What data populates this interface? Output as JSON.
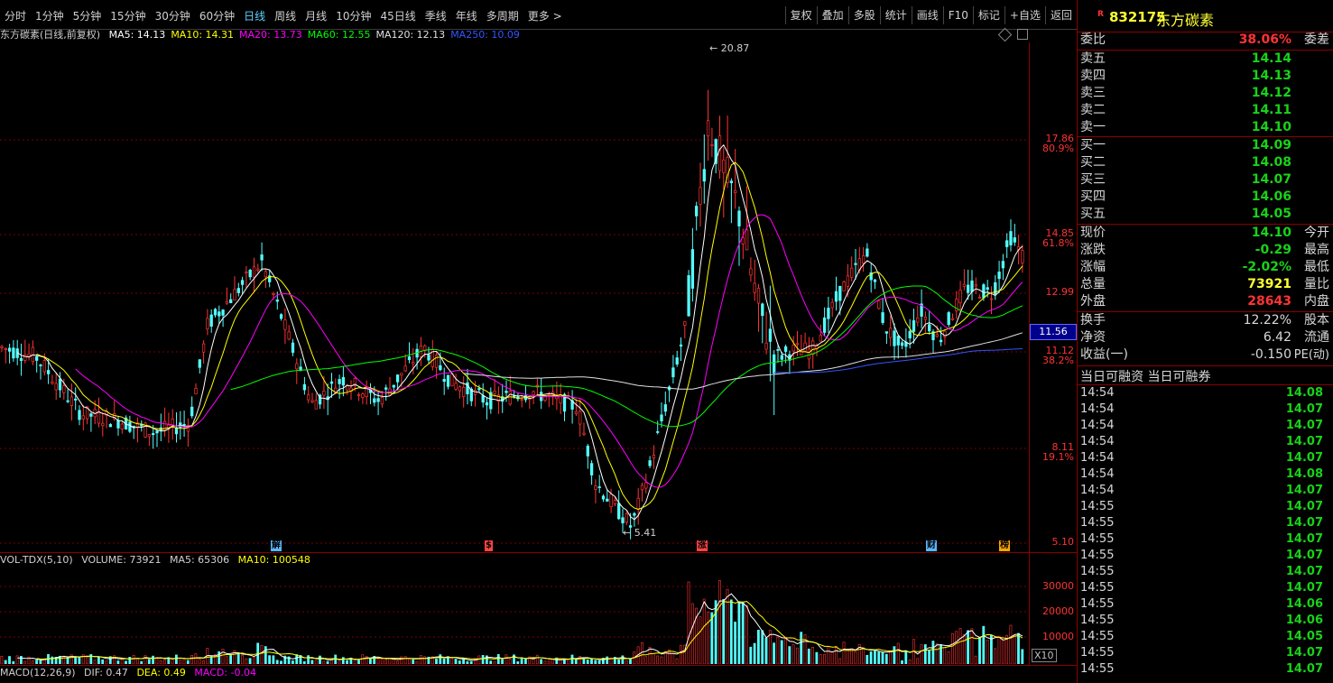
{
  "toolbar": {
    "periods": [
      "分时",
      "1分钟",
      "5分钟",
      "15分钟",
      "30分钟",
      "60分钟",
      "日线",
      "周线",
      "月线",
      "10分钟",
      "45日线",
      "季线",
      "年线",
      "多周期",
      "更多 >"
    ],
    "active_period": "日线",
    "tools": [
      "复权",
      "叠加",
      "多股",
      "统计",
      "画线",
      "F10",
      "标记",
      "+自选",
      "返回"
    ]
  },
  "main_legend": {
    "title": "东方碳素(日线,前复权)",
    "items": [
      {
        "text": "MA5: 14.13",
        "color": "#ffffff"
      },
      {
        "text": "MA10: 14.31",
        "color": "#ffff00"
      },
      {
        "text": "MA20: 13.73",
        "color": "#ff00ff"
      },
      {
        "text": "MA60: 12.55",
        "color": "#00ff00"
      },
      {
        "text": "MA120: 12.13",
        "color": "#e0e0e0"
      },
      {
        "text": "MA250: 10.09",
        "color": "#3355ff"
      }
    ]
  },
  "price_axis": [
    {
      "price": "17.86",
      "pct": "80.9%"
    },
    {
      "price": "14.85",
      "pct": "61.8%"
    },
    {
      "price": "12.99",
      "pct": ""
    },
    {
      "price": "11.12",
      "pct": "38.2%"
    },
    {
      "price": "8.11",
      "pct": "19.1%"
    },
    {
      "price": "5.10",
      "pct": ""
    }
  ],
  "current_price_box": "11.56",
  "high_marker": "20.87",
  "low_marker": "5.41",
  "events": [
    {
      "label": "解",
      "color": "#5bb6ff"
    },
    {
      "label": "$",
      "color": "#ff4444"
    },
    {
      "label": "涨",
      "color": "#ff4444"
    },
    {
      "label": "财",
      "color": "#5bb6ff"
    },
    {
      "label": "榜",
      "color": "#ffa500"
    }
  ],
  "volume_legend": {
    "title": "VOL-TDX(5,10)",
    "volume": "VOLUME: 73921",
    "ma5": "MA5: 65306",
    "ma10": "MA10: 100548"
  },
  "volume_axis": [
    "30000",
    "20000",
    "10000",
    "X10"
  ],
  "macd_legend": {
    "title": "MACD(12,26,9)",
    "dif": "DIF: 0.47",
    "dea": "DEA: 0.49",
    "macd": "MACD: -0.04"
  },
  "quote": {
    "code": "832175",
    "name": "东方碳素",
    "ratio_label": "委比",
    "ratio_value": "38.06%",
    "ratio_label2": "委差",
    "asks": [
      {
        "label": "卖五",
        "price": "14.14"
      },
      {
        "label": "卖四",
        "price": "14.13"
      },
      {
        "label": "卖三",
        "price": "14.12"
      },
      {
        "label": "卖二",
        "price": "14.11"
      },
      {
        "label": "卖一",
        "price": "14.10"
      }
    ],
    "bids": [
      {
        "label": "买一",
        "price": "14.09"
      },
      {
        "label": "买二",
        "price": "14.08"
      },
      {
        "label": "买三",
        "price": "14.07"
      },
      {
        "label": "买四",
        "price": "14.06"
      },
      {
        "label": "买五",
        "price": "14.05"
      }
    ],
    "stats": [
      {
        "label": "现价",
        "value": "14.10",
        "color": "#19d219",
        "label2": "今开"
      },
      {
        "label": "涨跌",
        "value": "-0.29",
        "color": "#19d219",
        "label2": "最高"
      },
      {
        "label": "涨幅",
        "value": "-2.02%",
        "color": "#19d219",
        "label2": "最低"
      },
      {
        "label": "总量",
        "value": "73921",
        "color": "#ffff33",
        "label2": "量比"
      },
      {
        "label": "外盘",
        "value": "28643",
        "color": "#ff3333",
        "label2": "内盘"
      }
    ],
    "stats2": [
      {
        "label": "换手",
        "value": "12.22%",
        "label2": "股本"
      },
      {
        "label": "净资",
        "value": "6.42",
        "label2": "流通"
      },
      {
        "label": "收益(一)",
        "value": "-0.150",
        "label2": "PE(动)"
      }
    ],
    "margin_label": "当日可融资 当日可融券",
    "ticks": [
      {
        "time": "14:54",
        "price": "14.08"
      },
      {
        "time": "14:54",
        "price": "14.07"
      },
      {
        "time": "14:54",
        "price": "14.07"
      },
      {
        "time": "14:54",
        "price": "14.07"
      },
      {
        "time": "14:54",
        "price": "14.07"
      },
      {
        "time": "14:54",
        "price": "14.08"
      },
      {
        "time": "14:54",
        "price": "14.07"
      },
      {
        "time": "14:55",
        "price": "14.07"
      },
      {
        "time": "14:55",
        "price": "14.07"
      },
      {
        "time": "14:55",
        "price": "14.07"
      },
      {
        "time": "14:55",
        "price": "14.07"
      },
      {
        "time": "14:55",
        "price": "14.07"
      },
      {
        "time": "14:55",
        "price": "14.07"
      },
      {
        "time": "14:55",
        "price": "14.06"
      },
      {
        "time": "14:55",
        "price": "14.06"
      },
      {
        "time": "14:55",
        "price": "14.05"
      },
      {
        "time": "14:55",
        "price": "14.07"
      },
      {
        "time": "14:55",
        "price": "14.07"
      }
    ]
  }
}
